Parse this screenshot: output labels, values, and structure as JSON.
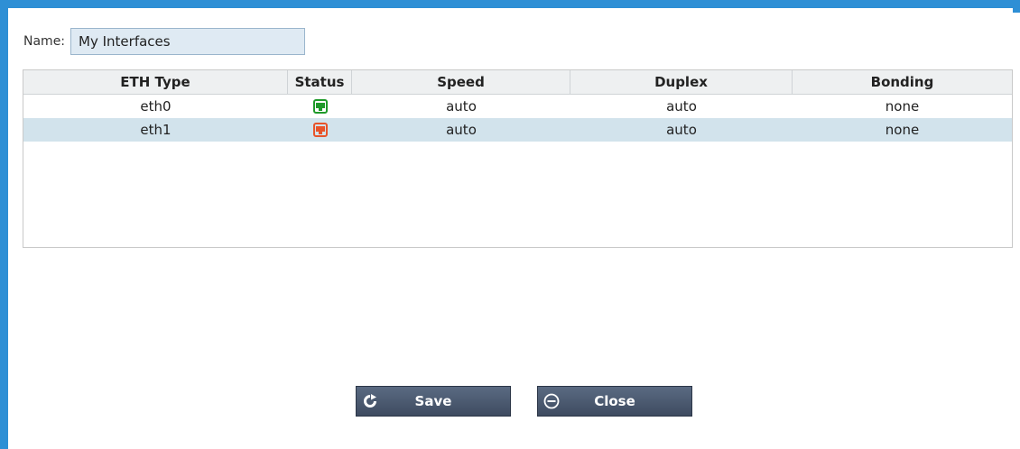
{
  "form": {
    "name_label": "Name:",
    "name_value": "My Interfaces"
  },
  "grid": {
    "columns": [
      "ETH Type",
      "Status",
      "Speed",
      "Duplex",
      "Bonding"
    ],
    "rows": [
      {
        "eth_type": "eth0",
        "status": "up",
        "status_color": "#1f9a2a",
        "speed": "auto",
        "duplex": "auto",
        "bonding": "none",
        "selected": false
      },
      {
        "eth_type": "eth1",
        "status": "down",
        "status_color": "#e8542a",
        "speed": "auto",
        "duplex": "auto",
        "bonding": "none",
        "selected": true
      }
    ]
  },
  "buttons": {
    "save_label": "Save",
    "save_icon": "refresh-icon",
    "close_label": "Close",
    "close_icon": "minus-circle-icon"
  },
  "colors": {
    "frame": "#2e8fd5",
    "selected_row": "#d2e3ec"
  }
}
